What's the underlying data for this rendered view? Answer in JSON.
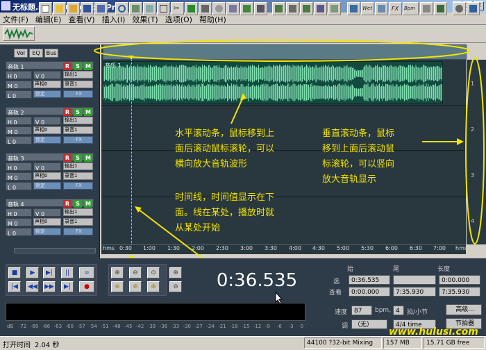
{
  "window": {
    "title": "无标题.ses* - Cool Edit Pro",
    "min": "_",
    "max": "□",
    "close": "×"
  },
  "menu": [
    "文件(F)",
    "编辑(E)",
    "查看(V)",
    "插入(I)",
    "效果(T)",
    "选项(O)",
    "帮助(H)"
  ],
  "left_tabs": [
    "Vol",
    "EQ",
    "Bus"
  ],
  "tracks": [
    {
      "name": "音轨 1",
      "h": "H 0",
      "m": "M 0",
      "l": "L 0",
      "v": "V 0",
      "pan": "声相0",
      "out": "输出1",
      "rec": "录音1",
      "lock": "锁定",
      "fx": "FX"
    },
    {
      "name": "音轨 2",
      "h": "H 0",
      "m": "M 0",
      "l": "L 0",
      "v": "V 0",
      "pan": "声相0",
      "out": "输出1",
      "rec": "录音1",
      "lock": "锁定",
      "fx": "FX"
    },
    {
      "name": "音轨 3",
      "h": "H 0",
      "m": "M 0",
      "l": "L 0",
      "v": "V 0",
      "pan": "声相0",
      "out": "输出1",
      "rec": "录音1",
      "lock": "锁定",
      "fx": "FX"
    },
    {
      "name": "音轨 4",
      "h": "H 0",
      "m": "M 0",
      "l": "L 0",
      "v": "V 0",
      "pan": "声相0",
      "out": "输出1",
      "rec": "录音1",
      "lock": "锁定",
      "fx": "FX"
    }
  ],
  "rsm": [
    "R",
    "S",
    "M"
  ],
  "clip_label": "音乐 1",
  "vscroll_numbers": [
    "1",
    "2",
    "3",
    "4"
  ],
  "ruler": [
    "hms",
    "0:30",
    "1:00",
    "1:30",
    "2:00",
    "2:30",
    "3:00",
    "3:30",
    "4:00",
    "4:30",
    "5:00",
    "5:30",
    "6:00",
    "6:30",
    "7:00",
    "hms"
  ],
  "time_display": "0:36.535",
  "time_table": {
    "col_start": "始",
    "col_end": "尾",
    "col_length": "长度",
    "row_select": "选",
    "row_view": "查看",
    "sel_start": "0:36.535",
    "sel_end": "",
    "sel_len": "0:00.000",
    "view_start": "0:00.000",
    "view_end": "7:35.930",
    "view_len": "7:35.930"
  },
  "tempo": {
    "speed_label": "速度",
    "bpm": "87",
    "bpm_unit": "bpm,",
    "beats": "4",
    "beats_unit": "拍/小节",
    "advanced": "高级...",
    "key_label": "调",
    "key": "（无）",
    "time_sig": "4/4 time",
    "metronome": "节拍器"
  },
  "level_scale": [
    "dB",
    "-72",
    "-69",
    "-66",
    "-63",
    "-60",
    "-57",
    "-54",
    "-51",
    "-48",
    "-45",
    "-42",
    "-39",
    "-36",
    "-33",
    "-30",
    "-27",
    "-24",
    "-21",
    "-18",
    "-15",
    "-12",
    "-9",
    "-6",
    "-3",
    "0"
  ],
  "status": {
    "open_time_label": "打开时间",
    "open_time": "2.04 秒",
    "format": "44100 ?32-bit Mixing",
    "mem": "157 MB",
    "disk": "15.71 GB free"
  },
  "watermark": "www.hulusi.com",
  "annotations": {
    "hscroll": [
      "水平滚动条，鼠标移到上",
      "面后滚动鼠标滚轮，可以",
      "横向放大音轨波形"
    ],
    "vscroll": [
      "垂直滚动条，鼠标",
      "移到上面后滚动鼠",
      "标滚轮，可以竖向",
      "放大音轨显示"
    ],
    "timeline": [
      "时间线，时间值显示在下",
      "面。线在某处，播放时就",
      "从某处开始"
    ]
  },
  "colors": {
    "accent": "#f4e400",
    "wave": "#7fe0b0",
    "panel": "#2e3b49",
    "track_bg": "#29383f"
  }
}
